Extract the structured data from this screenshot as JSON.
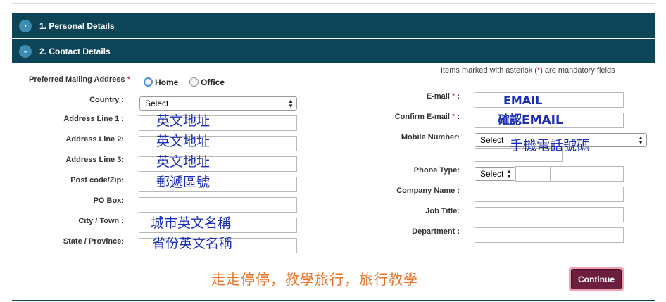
{
  "sections": [
    {
      "title": "1. Personal Details",
      "icon": "chevron-right-icon"
    },
    {
      "title": "2. Contact Details",
      "icon": "chevron-down-icon"
    }
  ],
  "mandatory_note": {
    "before": "Items marked with asterisk (",
    "star": "*",
    "after": ") are mandatory fields"
  },
  "left_form": {
    "mailing_label": "Preferred Mailing Address",
    "star": "*",
    "options": [
      "Home",
      "Office"
    ],
    "selected_option": "Home",
    "country_label": "Country :",
    "country_value": "Select",
    "address1_label": "Address Line 1 :",
    "address2_label": "Address Line 2:",
    "address3_label": "Address Line 3:",
    "postcode_label": "Post code/Zip:",
    "pobox_label": "PO Box:",
    "city_label": "City / Town :",
    "state_label": "State / Province:"
  },
  "right_form": {
    "email_label": "E-mail",
    "confirm_email_label": "Confirm E-mail",
    "star": "*",
    "colon": ":",
    "mobile_label": "Mobile Number:",
    "mobile_select": "Select",
    "phone_type_label": "Phone Type:",
    "phone_type_select": "Select",
    "company_label": "Company Name :",
    "job_label": "Job Title:",
    "dept_label": "Department :"
  },
  "annotations": {
    "address1": "英文地址",
    "address2": "英文地址",
    "address3": "英文地址",
    "postcode": "郵遞區號",
    "city": "城市英文名稱",
    "state": "省份英文名稱",
    "email": "EMAIL",
    "confirm_email": "確認EMAIL",
    "mobile": "手機電話號碼",
    "caption": "走走停停，教學旅行，旅行教學"
  },
  "continue_label": "Continue",
  "colors": {
    "header_bg": "#0d4457",
    "annotation": "#1b2fb5",
    "caption": "#e8752a",
    "button": "#6b1e3e"
  }
}
